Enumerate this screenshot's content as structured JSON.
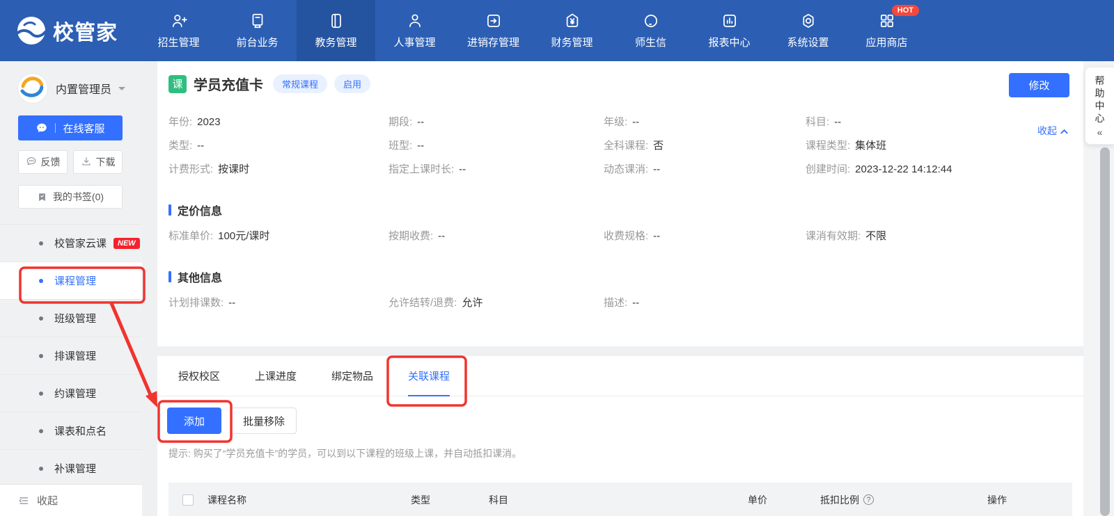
{
  "nav": {
    "logo": "校管家",
    "hot_badge": "HOT",
    "items": [
      {
        "label": "招生管理"
      },
      {
        "label": "前台业务"
      },
      {
        "label": "教务管理"
      },
      {
        "label": "人事管理"
      },
      {
        "label": "进销存管理"
      },
      {
        "label": "财务管理"
      },
      {
        "label": "师生信"
      },
      {
        "label": "报表中心"
      },
      {
        "label": "系统设置"
      },
      {
        "label": "应用商店"
      }
    ]
  },
  "sidebar": {
    "user_name": "内置管理员",
    "online_service": "在线客服",
    "feedback": "反馈",
    "download": "下载",
    "bookmarks": "我的书签(0)",
    "new_badge": "NEW",
    "menu": [
      {
        "label": "校管家云课"
      },
      {
        "label": "课程管理"
      },
      {
        "label": "班级管理"
      },
      {
        "label": "排课管理"
      },
      {
        "label": "约课管理"
      },
      {
        "label": "课表和点名"
      },
      {
        "label": "补课管理"
      }
    ],
    "collapse": "收起"
  },
  "detail": {
    "course_badge": "课",
    "title": "学员充值卡",
    "tags": [
      "常规课程",
      "启用"
    ],
    "edit_button": "修改",
    "collapse_link": "收起",
    "basic_rows": [
      [
        {
          "label": "年份:",
          "value": "2023"
        },
        {
          "label": "期段:",
          "value": "--"
        },
        {
          "label": "年级:",
          "value": "--"
        },
        {
          "label": "科目:",
          "value": "--"
        }
      ],
      [
        {
          "label": "类型:",
          "value": "--"
        },
        {
          "label": "班型:",
          "value": "--"
        },
        {
          "label": "全科课程:",
          "value": "否"
        },
        {
          "label": "课程类型:",
          "value": "集体班"
        }
      ],
      [
        {
          "label": "计费形式:",
          "value": "按课时"
        },
        {
          "label": "指定上课时长:",
          "value": "--"
        },
        {
          "label": "动态课消:",
          "value": "--"
        },
        {
          "label": "创建时间:",
          "value": "2023-12-22 14:12:44"
        }
      ]
    ],
    "pricing_title": "定价信息",
    "pricing_row": [
      {
        "label": "标准单价:",
        "value": "100元/课时"
      },
      {
        "label": "按期收费:",
        "value": "--"
      },
      {
        "label": "收费规格:",
        "value": "--"
      },
      {
        "label": "课消有效期:",
        "value": "不限"
      }
    ],
    "other_title": "其他信息",
    "other_row": [
      {
        "label": "计划排课数:",
        "value": "--"
      },
      {
        "label": "允许结转/退费:",
        "value": "允许"
      },
      {
        "label": "描述:",
        "value": "--"
      }
    ]
  },
  "tabs_panel": {
    "tabs": [
      "授权校区",
      "上课进度",
      "绑定物品",
      "关联课程"
    ],
    "add_button": "添加",
    "remove_button": "批量移除",
    "hint": "提示: 购买了“学员充值卡”的学员，可以到以下课程的班级上课，并自动抵扣课消。",
    "ratio_help_glyph": "?",
    "table_headers": [
      "课程名称",
      "类型",
      "科目",
      "单价",
      "抵扣比例",
      "操作"
    ]
  },
  "help_panel": {
    "label": "帮助中心",
    "chevron": "«"
  },
  "colors": {
    "nav_blue": "#2c5fb3",
    "nav_active_blue": "#24539f",
    "accent_blue": "#3370ff",
    "badge_green": "#2fbe80",
    "badge_red": "#f5222d",
    "annotation_red": "#f0342f"
  }
}
